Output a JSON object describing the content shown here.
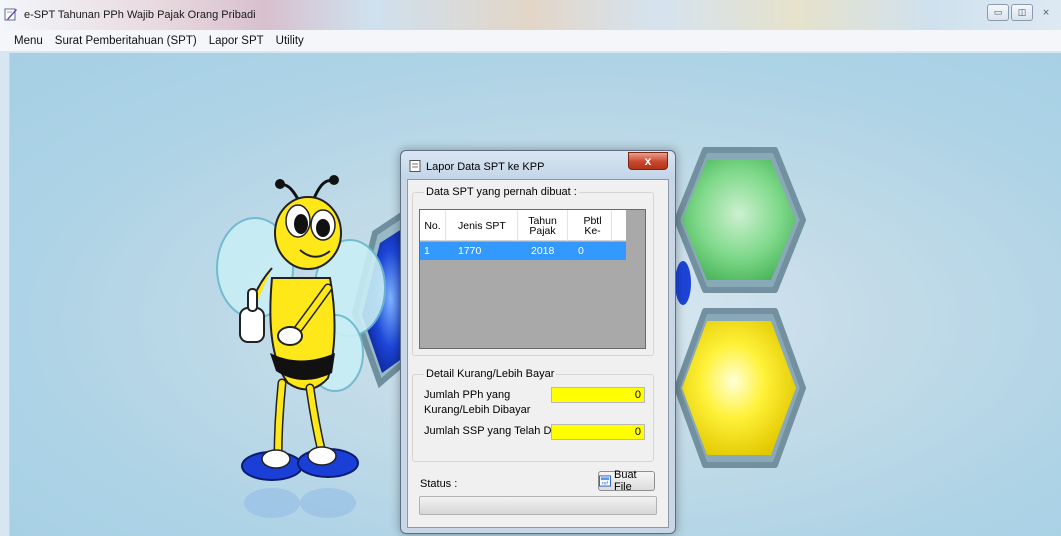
{
  "window": {
    "title": "e-SPT Tahunan PPh Wajib Pajak Orang Pribadi",
    "minimize_glyph": "▭",
    "maximize_glyph": "◫",
    "close_glyph": "⨯"
  },
  "menubar": {
    "items": [
      "Menu",
      "Surat Pemberitahuan (SPT)",
      "Lapor SPT",
      "Utility"
    ]
  },
  "dialog": {
    "title": "Lapor Data SPT ke KPP",
    "close_glyph": "x",
    "list_group_label": "Data SPT yang pernah dibuat :",
    "columns": [
      "No.",
      "Jenis SPT",
      "Tahun Pajak",
      "Pbtl Ke-"
    ],
    "rows": [
      {
        "no": "1",
        "jenis": "1770",
        "tahun": "2018",
        "pbtl": "0",
        "selected": true
      }
    ],
    "detail_group_label": "Detail Kurang/Lebih Bayar",
    "pph_label": "Jumlah PPh yang Kurang/Lebih Dibayar",
    "pph_value": "0",
    "ssp_label": "Jumlah SSP yang Telah Dibayar",
    "ssp_value": "0",
    "buat_file_label": "Buat File",
    "status_label": "Status :",
    "progress": 0
  },
  "colors": {
    "selection": "#3399ff",
    "input_highlight": "#ffff00",
    "background": "#add3e6"
  }
}
